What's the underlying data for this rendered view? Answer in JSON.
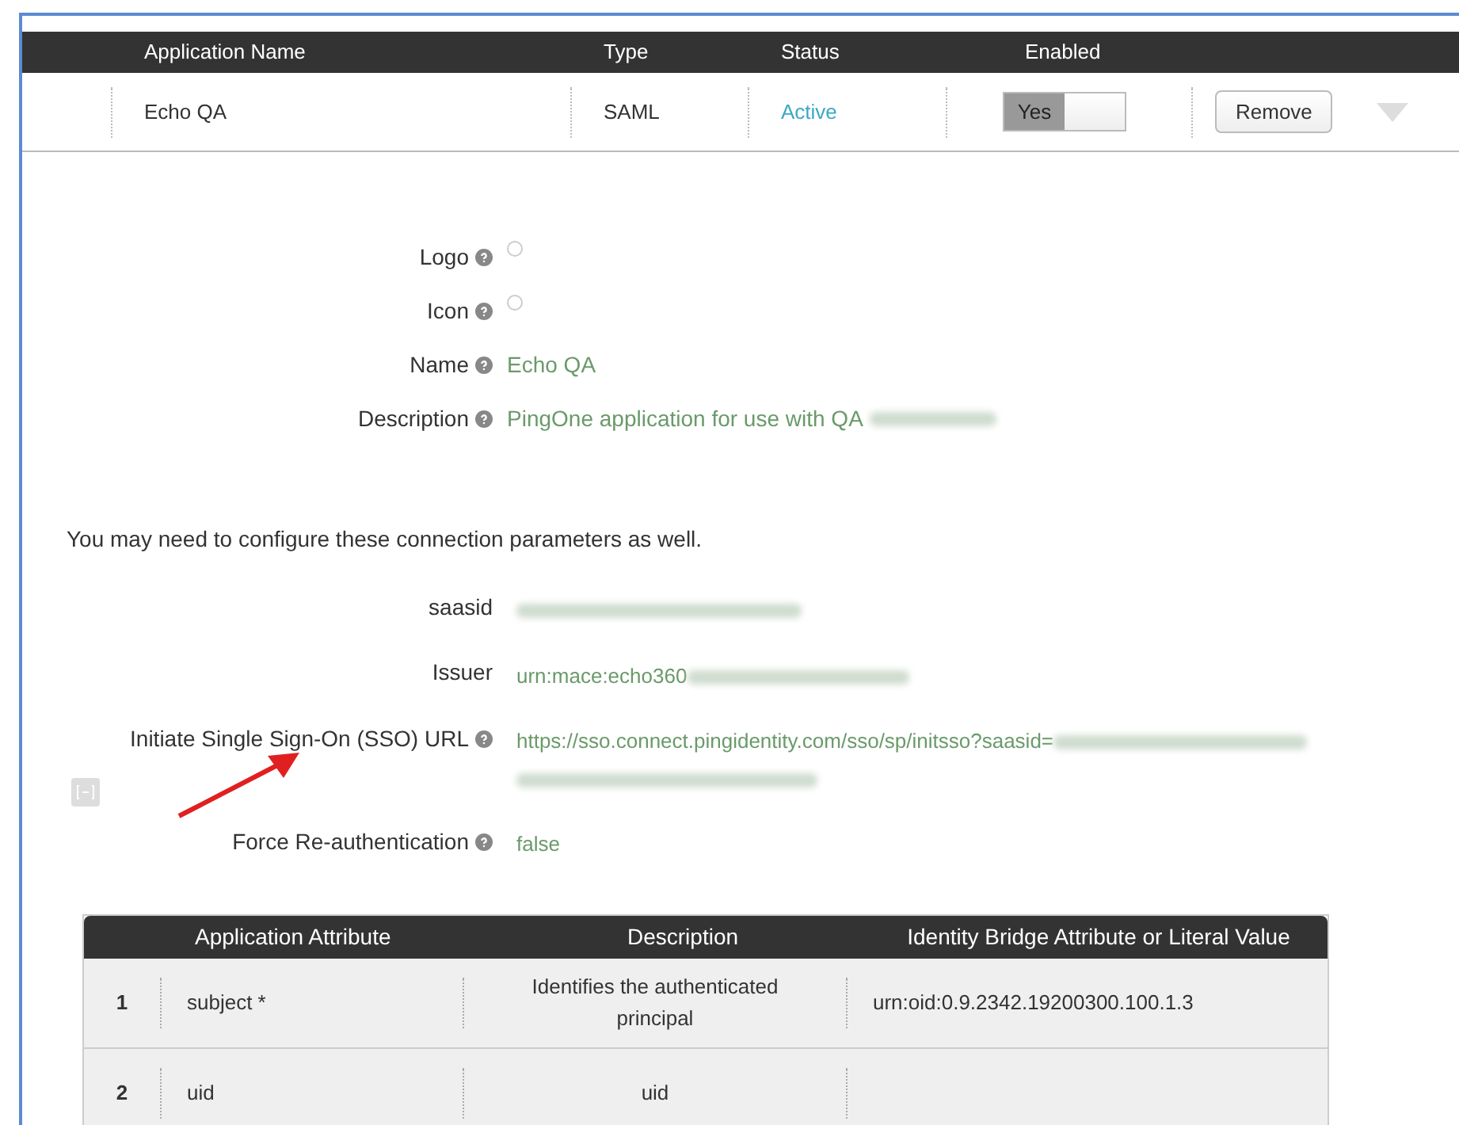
{
  "app_table": {
    "columns": [
      "Application Name",
      "Type",
      "Status",
      "Enabled"
    ],
    "row": {
      "name": "Echo QA",
      "type": "SAML",
      "status": "Active",
      "enabled": {
        "label": "Yes",
        "on": true
      },
      "remove": "Remove"
    }
  },
  "details": [
    {
      "label": "Logo",
      "kind": "radio",
      "selected": false
    },
    {
      "label": "Icon",
      "kind": "radio",
      "selected": false
    },
    {
      "label": "Name",
      "kind": "text",
      "value": "Echo QA"
    },
    {
      "label": "Description",
      "kind": "text",
      "value": "PingOne application for use with QA",
      "redacted": true
    }
  ],
  "note": "You may need to configure these connection parameters as well.",
  "parameters": [
    {
      "label": "saasid",
      "help": false,
      "redacted": true
    },
    {
      "label": "Issuer",
      "help": false,
      "value": "urn:mace:echo360",
      "redacted": true
    },
    {
      "label": "Initiate Single Sign-On (SSO) URL",
      "help": true,
      "value": "https://sso.connect.pingidentity.com/sso/sp/initsso?saasid=",
      "redacted": true,
      "wrap": true
    },
    {
      "label": "Force Re-authentication",
      "help": true,
      "value": "false",
      "redacted": false
    }
  ],
  "attributes": {
    "columns": [
      "Application Attribute",
      "Description",
      "Identity Bridge Attribute or Literal Value"
    ],
    "rows": [
      {
        "index": "1",
        "attribute": "subject *",
        "description": "Identifies the authenticated principal",
        "value": "urn:oid:0.9.2342.19200300.100.1.3"
      },
      {
        "index": "2",
        "attribute": "uid",
        "description": "uid"
      }
    ]
  }
}
